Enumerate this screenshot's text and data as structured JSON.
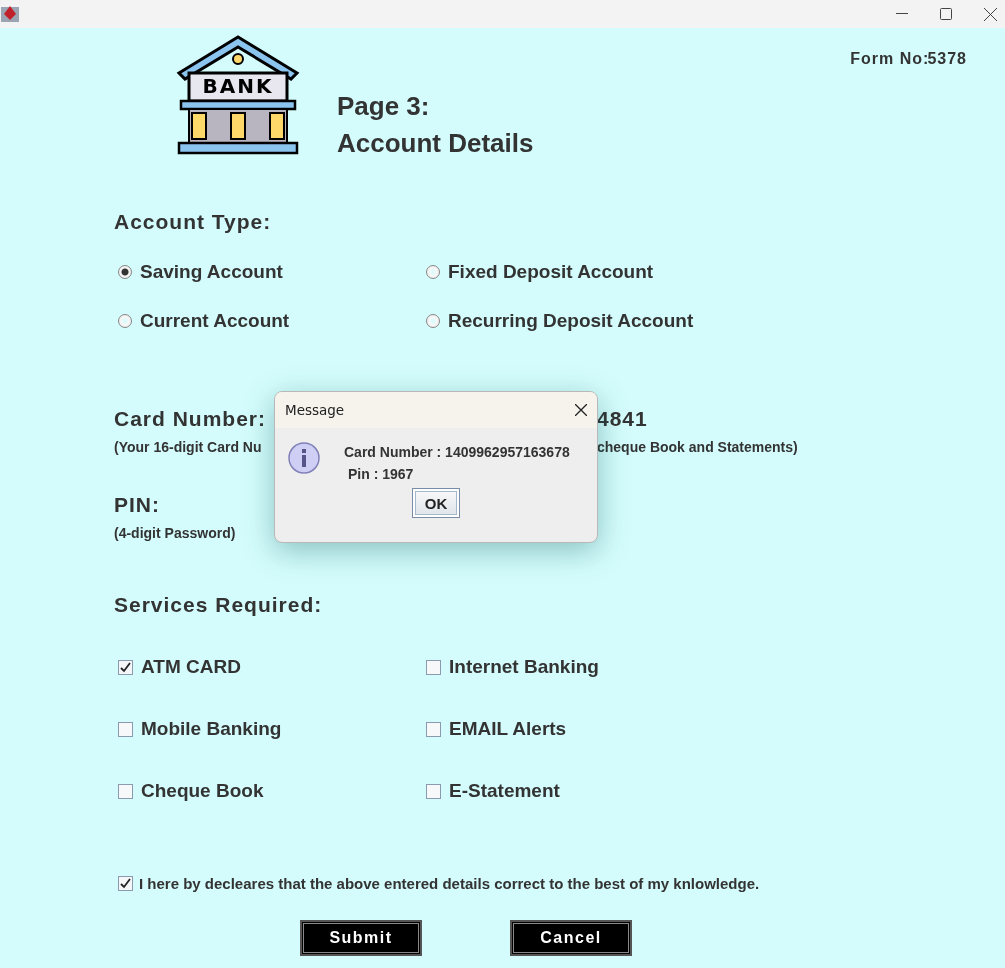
{
  "header": {
    "form_label": "Form No:",
    "form_number": "5378",
    "title_line_1": "Page 3:",
    "title_line_2": "Account Details",
    "logo_text": "BANK"
  },
  "account_type": {
    "heading": "Account Type:",
    "options": [
      {
        "label": "Saving Account",
        "selected": true
      },
      {
        "label": "Fixed Deposit Account",
        "selected": false
      },
      {
        "label": "Current Account",
        "selected": false
      },
      {
        "label": "Recurring Deposit Account",
        "selected": false
      }
    ]
  },
  "card": {
    "heading": "Card Number:",
    "value_visible": "4841",
    "note_left": "(Your 16-digit Card Nu",
    "note_right": "cheque Book and Statements)"
  },
  "pin": {
    "heading": "PIN:",
    "note": "(4-digit Password)"
  },
  "services": {
    "heading": "Services Required:",
    "options": [
      {
        "label": "ATM CARD",
        "checked": true
      },
      {
        "label": "Internet Banking",
        "checked": false
      },
      {
        "label": "Mobile Banking",
        "checked": false
      },
      {
        "label": "EMAIL Alerts",
        "checked": false
      },
      {
        "label": "Cheque Book",
        "checked": false
      },
      {
        "label": "E-Statement",
        "checked": false
      }
    ]
  },
  "declaration": {
    "label": "I here by decleares that the above entered details correct to the best of my knlowledge.",
    "checked": true
  },
  "buttons": [
    "Submit",
    "Cancel"
  ],
  "dialog": {
    "title": "Message",
    "line_1": "Card Number : 1409962957163678",
    "line_2": "Pin : 1967",
    "button": "OK"
  }
}
